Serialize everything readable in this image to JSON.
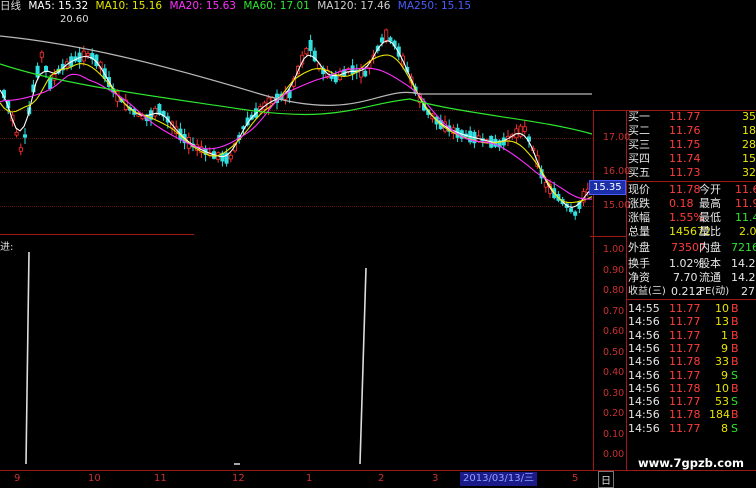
{
  "legend": {
    "prefix": "日线",
    "ma5": "MA5: 15.32",
    "ma10": "MA10: 15.16",
    "ma20": "MA20: 15.63",
    "ma60": "MA60: 17.01",
    "ma120": "MA120: 17.46",
    "ma250": "MA250: 15.15",
    "colors": {
      "ma5": "#ffffff",
      "ma10": "#e6e600",
      "ma20": "#ff30ff",
      "ma60": "#2ee62e",
      "ma120": "#b8b8b8",
      "ma250": "#4a5cff"
    }
  },
  "price_chart": {
    "high_label": "20.60",
    "axis_ticks": [
      "17.00",
      "16.00",
      "15.00"
    ],
    "current_price_tag": "15.35"
  },
  "indicator": {
    "label": "进:",
    "axis_ticks": [
      "1.00",
      "0.90",
      "0.80",
      "0.70",
      "0.60",
      "0.50",
      "0.40",
      "0.30",
      "0.20",
      "0.10",
      "0.00"
    ]
  },
  "quote": {
    "bids": [
      {
        "label": "买一",
        "price": "11.77",
        "vol": "35"
      },
      {
        "label": "买二",
        "price": "11.76",
        "vol": "18"
      },
      {
        "label": "买三",
        "price": "11.75",
        "vol": "28"
      },
      {
        "label": "买四",
        "price": "11.74",
        "vol": "15"
      },
      {
        "label": "买五",
        "price": "11.73",
        "vol": "32"
      }
    ],
    "stats": [
      {
        "l1": "现价",
        "v1": "11.78",
        "l2": "今开",
        "v2": "11.6"
      },
      {
        "l1": "涨跌",
        "v1": "0.18",
        "l2": "最高",
        "v2": "11.9"
      },
      {
        "l1": "涨幅",
        "v1": "1.55%",
        "l2": "最低",
        "v2": "11.4"
      },
      {
        "l1": "总量",
        "v1": "145672",
        "l2": "量比",
        "v2": "2.0"
      },
      {
        "l1": "外盘",
        "v1": "73507",
        "l2": "内盘",
        "v2": "7216"
      },
      {
        "l1": "换手",
        "v1": "1.02%",
        "l2": "股本",
        "v2": "14.2"
      },
      {
        "l1": "净资",
        "v1": "7.70",
        "l2": "流通",
        "v2": "14.2"
      },
      {
        "l1": "收益(三)",
        "v1": "0.212",
        "l2": "PE(动)",
        "v2": "27"
      }
    ],
    "ticks": [
      {
        "time": "14:55",
        "price": "11.77",
        "vol": "10",
        "side": "B"
      },
      {
        "time": "14:56",
        "price": "11.77",
        "vol": "13",
        "side": "B"
      },
      {
        "time": "14:56",
        "price": "11.77",
        "vol": "1",
        "side": "B"
      },
      {
        "time": "14:56",
        "price": "11.77",
        "vol": "9",
        "side": "B"
      },
      {
        "time": "14:56",
        "price": "11.78",
        "vol": "33",
        "side": "B"
      },
      {
        "time": "14:56",
        "price": "11.77",
        "vol": "9",
        "side": "S"
      },
      {
        "time": "14:56",
        "price": "11.78",
        "vol": "10",
        "side": "B"
      },
      {
        "time": "14:56",
        "price": "11.77",
        "vol": "53",
        "side": "S"
      },
      {
        "time": "14:56",
        "price": "11.78",
        "vol": "184",
        "side": "B"
      },
      {
        "time": "14:56",
        "price": "11.77",
        "vol": "8",
        "side": "S"
      }
    ]
  },
  "bottom_axis": {
    "months": [
      "9",
      "10",
      "11",
      "12",
      "1",
      "2",
      "3",
      "5"
    ],
    "date_cursor": "2013/03/13/三",
    "period_button": "日"
  },
  "watermark": "www.7gpzb.com"
}
